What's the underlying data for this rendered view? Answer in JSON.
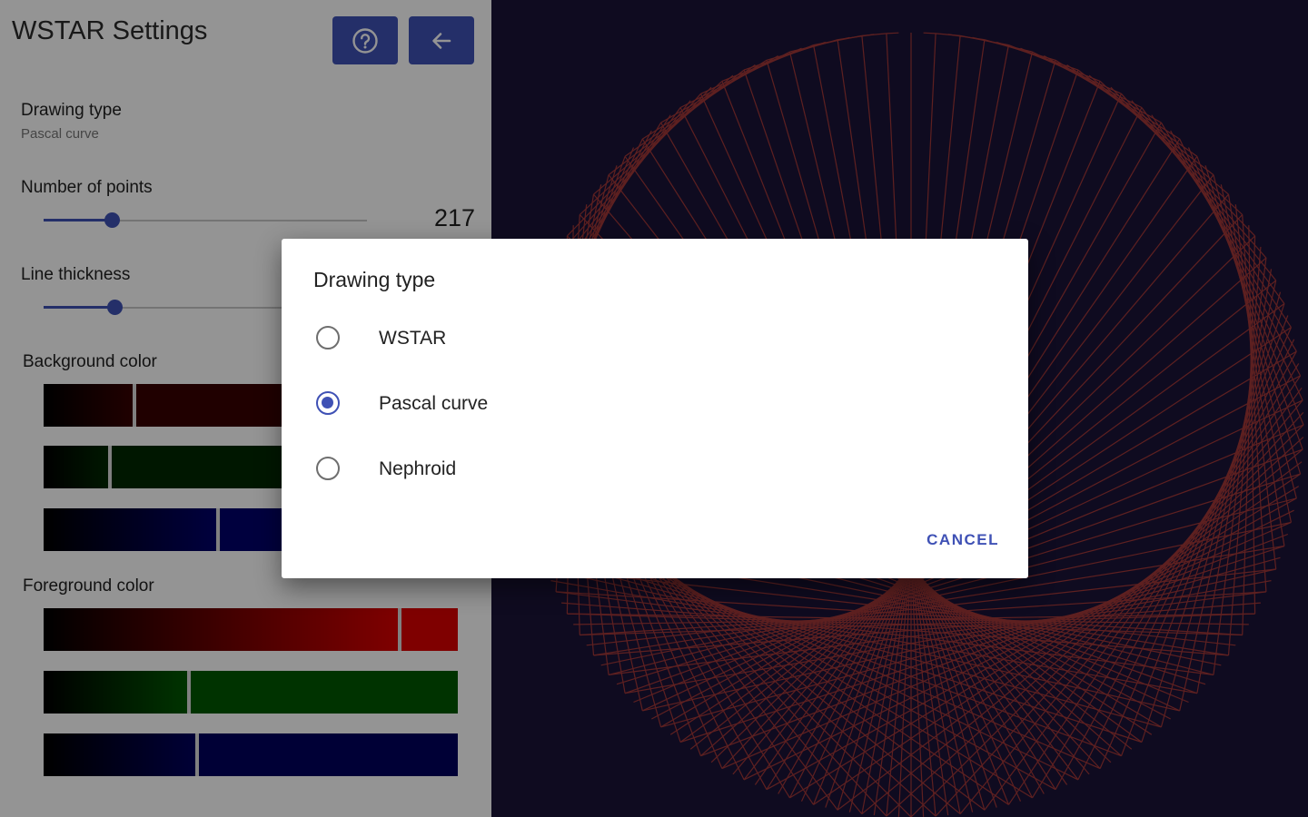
{
  "settings": {
    "title": "WSTAR Settings",
    "help_icon": "help-circle-icon",
    "back_icon": "arrow-back-icon",
    "drawing_type": {
      "label": "Drawing type",
      "value": "Pascal curve"
    },
    "number_of_points": {
      "label": "Number of points",
      "value": "217",
      "fraction": 0.21
    },
    "line_thickness": {
      "label": "Line thickness",
      "fraction": 0.22
    },
    "background_color": {
      "label": "Background color",
      "red_fraction": 0.22,
      "green_fraction": 0.16,
      "blue_fraction": 0.42
    },
    "foreground_color": {
      "label": "Foreground color",
      "red_fraction": 0.86,
      "green_fraction": 0.35,
      "blue_fraction": 0.37
    }
  },
  "canvas": {
    "background": "#1b1438",
    "line_color": "#a23838",
    "curve": "Pascal curve"
  },
  "dialog": {
    "title": "Drawing type",
    "options": [
      {
        "label": "WSTAR",
        "selected": false
      },
      {
        "label": "Pascal curve",
        "selected": true
      },
      {
        "label": "Nephroid",
        "selected": false
      }
    ],
    "cancel_label": "CANCEL"
  },
  "colors": {
    "accent": "#3f51b5",
    "scrim": "rgba(0,0,0,0.42)"
  }
}
